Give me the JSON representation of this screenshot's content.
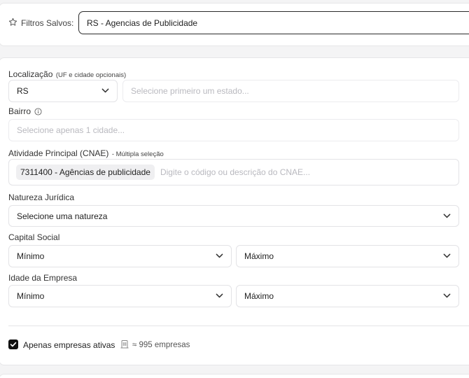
{
  "saved_filters": {
    "label": "Filtros Salvos:",
    "value": "RS - Agencias de Publicidade"
  },
  "location": {
    "label": "Localização",
    "hint": "(UF e cidade opcionais)",
    "uf_value": "RS",
    "city_placeholder": "Selecione primeiro um estado..."
  },
  "neighborhood": {
    "label": "Bairro",
    "placeholder": "Selecione apenas 1 cidade..."
  },
  "cnae": {
    "label": "Atividade Principal (CNAE)",
    "hint": "- Múltipla seleção",
    "tags": [
      "7311400 - Agências de publicidade"
    ],
    "placeholder": "Digite o código ou descrição do CNAE..."
  },
  "legal_nature": {
    "label": "Natureza Jurídica",
    "value": "Selecione uma natureza"
  },
  "capital": {
    "label": "Capital Social",
    "min": "Mínimo",
    "max": "Máximo"
  },
  "age": {
    "label": "Idade da Empresa",
    "min": "Mínimo",
    "max": "Máximo"
  },
  "active_only": {
    "label": "Apenas empresas ativas",
    "checked": true,
    "count_text": "≈ 995 empresas"
  },
  "colors": {
    "checkbox": "#111111",
    "border": "#e3e3e6",
    "placeholder": "#b9b9bf"
  },
  "icons": [
    "star-icon",
    "chevron-down-icon",
    "info-icon",
    "building-icon",
    "check-icon"
  ]
}
